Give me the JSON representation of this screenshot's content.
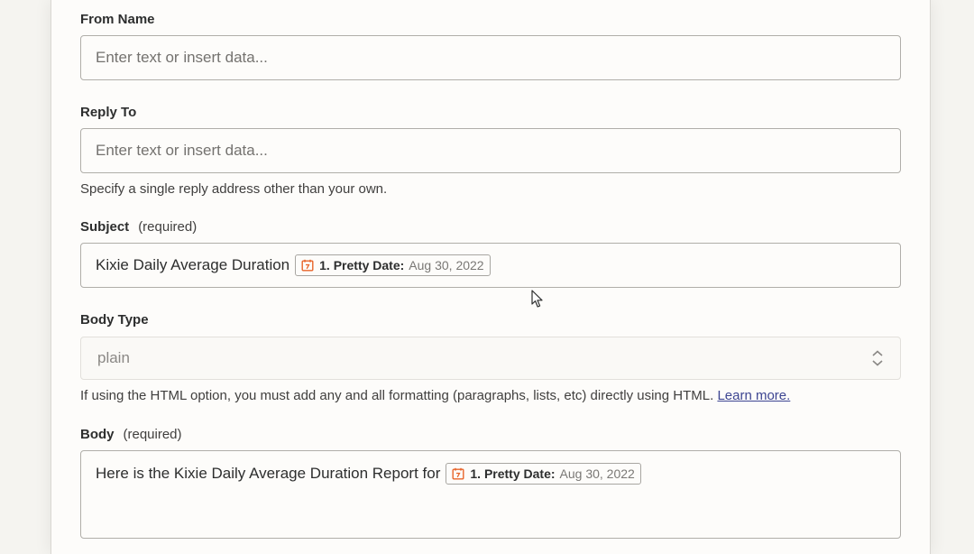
{
  "from_name": {
    "label": "From Name",
    "placeholder": "Enter text or insert data..."
  },
  "reply_to": {
    "label": "Reply To",
    "placeholder": "Enter text or insert data...",
    "hint": "Specify a single reply address other than your own."
  },
  "subject": {
    "label": "Subject",
    "required": "(required)",
    "text": "Kixie Daily Average Duration",
    "pill": {
      "icon": "calendar-icon",
      "step": "1. Pretty Date:",
      "value": "Aug 30, 2022"
    }
  },
  "body_type": {
    "label": "Body Type",
    "selected": "plain",
    "hint": "If using the HTML option, you must add any and all formatting (paragraphs, lists, etc) directly using HTML.",
    "link": "Learn more."
  },
  "body": {
    "label": "Body",
    "required": "(required)",
    "text": "Here is the Kixie Daily Average Duration Report for",
    "pill": {
      "icon": "calendar-icon",
      "step": "1. Pretty Date:",
      "value": "Aug 30, 2022"
    }
  },
  "colors": {
    "pill_icon": "#e8642a",
    "link": "#3d4592"
  }
}
